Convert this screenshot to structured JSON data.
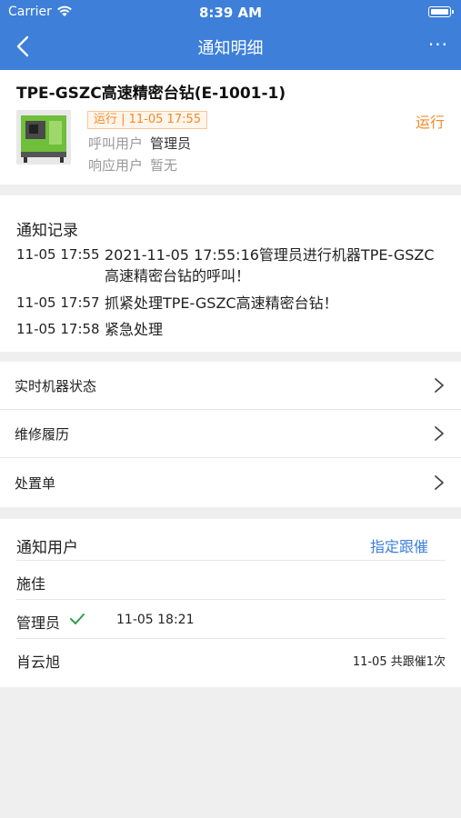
{
  "status_bar": {
    "carrier": "Carrier",
    "time": "8:39 AM"
  },
  "nav": {
    "title": "通知明细",
    "more": "···"
  },
  "machine": {
    "title": "TPE-GSZC高速精密台钻(E-1001-1)",
    "status_tag": "运行 | 11-05 17:55",
    "status": "运行",
    "caller_label": "呼叫用户",
    "caller_value": "管理员",
    "responder_label": "响应用户",
    "responder_value": "暂无"
  },
  "records": {
    "title": "通知记录",
    "items": [
      {
        "time": "11-05 17:55",
        "text": "2021-11-05 17:55:16管理员进行机器TPE-GSZC高速精密台钻的呼叫！"
      },
      {
        "time": "11-05 17:57",
        "text": "抓紧处理TPE-GSZC高速精密台钻！"
      },
      {
        "time": "11-05 17:58",
        "text": "紧急处理"
      }
    ]
  },
  "menu": {
    "items": [
      {
        "label": "实时机器状态"
      },
      {
        "label": "维修履历"
      },
      {
        "label": "处置单"
      }
    ]
  },
  "users": {
    "title": "通知用户",
    "assign_label": "指定跟催",
    "rows": [
      {
        "name": "施佳",
        "time": "",
        "right": ""
      },
      {
        "name": "管理员",
        "time": "11-05 18:21",
        "right": ""
      },
      {
        "name": "肖云旭",
        "time": "",
        "right": "11-05 共跟催1次"
      }
    ]
  },
  "colors": {
    "header": "#3d7fd9",
    "accent_orange": "#f08b28",
    "link_blue": "#3d7fd9",
    "check_green": "#2e9e4a"
  },
  "icons": {
    "back": "chevron-left-icon",
    "more": "more-icon",
    "chevron": "chevron-right-icon",
    "check": "check-icon",
    "wifi": "wifi-icon",
    "battery": "battery-icon"
  }
}
